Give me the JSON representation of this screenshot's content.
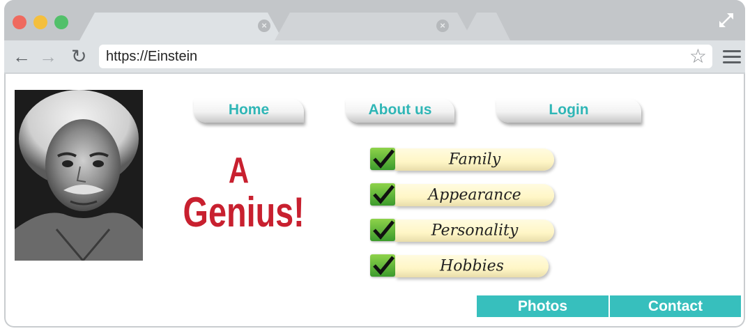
{
  "browser": {
    "url": "https://Einstein",
    "tabs": [
      {
        "label": "",
        "active": true
      },
      {
        "label": "",
        "active": false
      }
    ]
  },
  "site": {
    "photo_alt": "Albert Einstein portrait",
    "nav": [
      {
        "label": "Home"
      },
      {
        "label": "About us"
      },
      {
        "label": "Login"
      }
    ],
    "headline": {
      "line1": "A",
      "line2": "Genius!"
    },
    "checklist": [
      {
        "label": "Family",
        "checked": true
      },
      {
        "label": "Appearance",
        "checked": true
      },
      {
        "label": "Personality",
        "checked": true
      },
      {
        "label": "Hobbies",
        "checked": true
      }
    ],
    "footer": [
      {
        "label": "Photos"
      },
      {
        "label": "Contact"
      }
    ]
  },
  "colors": {
    "accent_teal": "#37bfbd",
    "headline_red": "#c8202f",
    "check_green": "#5cb936"
  }
}
